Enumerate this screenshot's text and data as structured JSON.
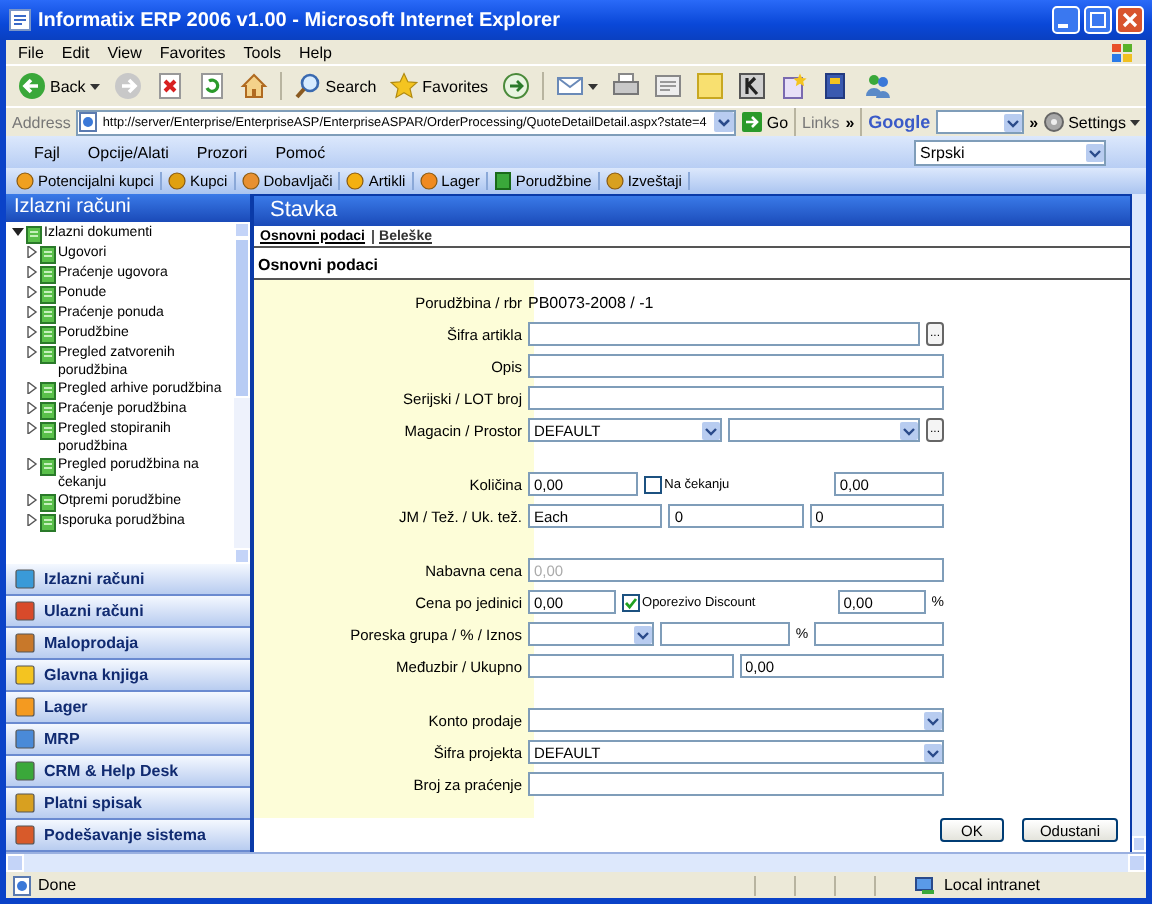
{
  "window": {
    "title": "Informatix ERP 2006 v1.00 - Microsoft Internet Explorer"
  },
  "ie_menu": [
    "File",
    "Edit",
    "View",
    "Favorites",
    "Tools",
    "Help"
  ],
  "ie_toolbar": [
    {
      "kind": "back",
      "label": "Back"
    },
    {
      "kind": "forward"
    },
    {
      "kind": "stop"
    },
    {
      "kind": "refresh"
    },
    {
      "kind": "home"
    },
    {
      "kind": "search",
      "label": "Search"
    },
    {
      "kind": "favorites",
      "label": "Favorites"
    },
    {
      "kind": "media"
    },
    {
      "kind": "mail"
    },
    {
      "kind": "print"
    },
    {
      "kind": "edit"
    },
    {
      "kind": "note"
    },
    {
      "kind": "k"
    },
    {
      "kind": "starpage"
    },
    {
      "kind": "book"
    },
    {
      "kind": "people"
    }
  ],
  "address_bar": {
    "label": "Address",
    "url": "http://server/Enterprise/EnterpriseASP/EnterpriseASPAR/OrderProcessing/QuoteDetailDetail.aspx?state=4",
    "go": "Go",
    "links": "Links",
    "links_more": "»",
    "google": "Google",
    "google_more": "»",
    "settings": "Settings"
  },
  "app_menu": [
    "Fajl",
    "Opcije/Alati",
    "Prozori",
    "Pomoć"
  ],
  "language": "Srpski",
  "app_toolbar": [
    "Potencijalni kupci",
    "Kupci",
    "Dobavljači",
    "Artikli",
    "Lager",
    "Porudžbine",
    "Izveštaji"
  ],
  "left_panel": {
    "title": "Izlazni računi",
    "tree": [
      {
        "label": "Izlazni dokumenti",
        "expanded": true,
        "children": [
          {
            "label": "Ugovori",
            "expanded": false
          },
          {
            "label": "Praćenje ugovora",
            "expanded": false
          },
          {
            "label": "Ponude",
            "expanded": false
          },
          {
            "label": "Praćenje ponuda",
            "expanded": false
          },
          {
            "label": "Porudžbine",
            "expanded": false
          },
          {
            "label": "Pregled zatvorenih porudžbina",
            "expanded": false
          },
          {
            "label": "Pregled arhive porudžbina",
            "expanded": false
          },
          {
            "label": "Praćenje porudžbina",
            "expanded": false
          },
          {
            "label": "Pregled stopiranih porudžbina",
            "expanded": false
          },
          {
            "label": "Pregled porudžbina na čekanju",
            "expanded": false
          },
          {
            "label": "Otpremi porudžbine",
            "expanded": false
          },
          {
            "label": "Isporuka porudžbina",
            "expanded": false
          }
        ]
      }
    ]
  },
  "nav_sections": [
    "Izlazni računi",
    "Ulazni računi",
    "Maloprodaja",
    "Glavna knjiga",
    "Lager",
    "MRP",
    "CRM & Help Desk",
    "Platni spisak",
    "Podešavanje sistema"
  ],
  "content": {
    "title": "Stavka",
    "tabs": [
      {
        "label": "Osnovni podaci",
        "selected": true
      },
      {
        "label": "Beleške",
        "selected": false
      }
    ],
    "section_title": "Osnovni podaci"
  },
  "form": {
    "groups": [
      {
        "rows": [
          {
            "label": "Porudžbina / rbr",
            "controls": [
              {
                "kind": "text",
                "value": "PB0073-2008 / -1"
              }
            ]
          },
          {
            "label": "Šifra artikla",
            "controls": [
              {
                "kind": "input"
              },
              {
                "kind": "browse",
                "label": "..."
              }
            ]
          },
          {
            "label": "Opis",
            "controls": [
              {
                "kind": "input"
              }
            ]
          },
          {
            "label": "Serijski / LOT broj",
            "controls": [
              {
                "kind": "input"
              }
            ]
          },
          {
            "label": "Magacin / Prostor",
            "controls": [
              {
                "kind": "select",
                "value": "DEFAULT"
              },
              {
                "kind": "select"
              },
              {
                "kind": "browse",
                "label": "..."
              }
            ]
          }
        ]
      },
      {
        "rows": [
          {
            "label": "Količina",
            "controls": [
              {
                "kind": "input",
                "value": "0,00"
              },
              {
                "kind": "checkbox",
                "label": "Na čekanju",
                "checked": false
              },
              {
                "kind": "input",
                "value": "0,00"
              }
            ]
          },
          {
            "label": "JM / Tež. / Uk. tež.",
            "controls": [
              {
                "kind": "input",
                "value": "Each"
              },
              {
                "kind": "input",
                "value": "0"
              },
              {
                "kind": "input",
                "value": "0"
              }
            ]
          }
        ]
      },
      {
        "rows": [
          {
            "label": "Nabavna cena",
            "controls": [
              {
                "kind": "input",
                "value": "0,00",
                "disabled": true
              }
            ]
          },
          {
            "label": "Cena po jedinici",
            "controls": [
              {
                "kind": "input",
                "value": "0,00"
              },
              {
                "kind": "checkbox",
                "label": "Oporezivo Discount",
                "checked": true
              },
              {
                "kind": "input",
                "value": "0,00"
              },
              {
                "kind": "unit",
                "label": "%"
              }
            ]
          },
          {
            "label": "Poreska grupa / % / Iznos",
            "controls": [
              {
                "kind": "select"
              },
              {
                "kind": "input"
              },
              {
                "kind": "unit",
                "label": "%"
              },
              {
                "kind": "input"
              }
            ]
          },
          {
            "label": "Međuzbir / Ukupno",
            "controls": [
              {
                "kind": "input"
              },
              {
                "kind": "input",
                "value": "0,00"
              }
            ]
          }
        ]
      },
      {
        "rows": [
          {
            "label": "Konto prodaje",
            "controls": [
              {
                "kind": "select"
              }
            ]
          },
          {
            "label": "Šifra projekta",
            "controls": [
              {
                "kind": "select",
                "value": "DEFAULT"
              }
            ]
          },
          {
            "label": "Broj za praćenje",
            "controls": [
              {
                "kind": "input"
              }
            ]
          }
        ]
      }
    ]
  },
  "buttons": [
    "OK",
    "Odustani"
  ],
  "status_bar": {
    "text": "Done",
    "zone": "Local intranet"
  }
}
